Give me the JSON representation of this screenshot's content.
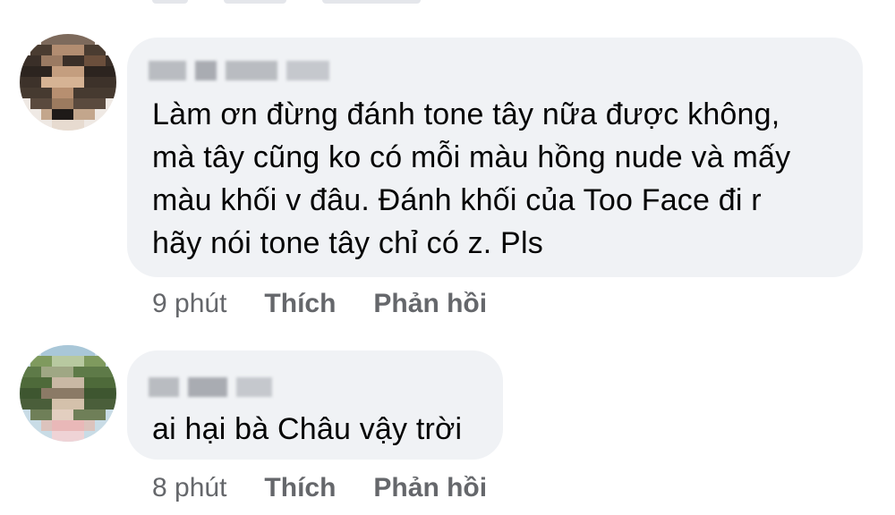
{
  "comments": [
    {
      "author": "",
      "text_lines": [
        "Làm ơn đừng đánh tone tây nữa được không,",
        "mà tây cũng ko có mỗi màu hồng nude và mấy",
        "màu khối v đâu. Đánh khối của Too Face đi r",
        "hãy nói tone tây chỉ có z. Pls"
      ],
      "time": "9 phút",
      "like_label": "Thích",
      "reply_label": "Phản hồi"
    },
    {
      "author": "",
      "text_lines": [
        "ai hại bà Châu vậy trời"
      ],
      "time": "8 phút",
      "like_label": "Thích",
      "reply_label": "Phản hồi"
    }
  ],
  "colors": {
    "bubble": "#f0f2f5",
    "text": "#050505",
    "meta": "#65676b"
  },
  "icons": [
    "avatar-pixelated",
    "name-blurred"
  ]
}
